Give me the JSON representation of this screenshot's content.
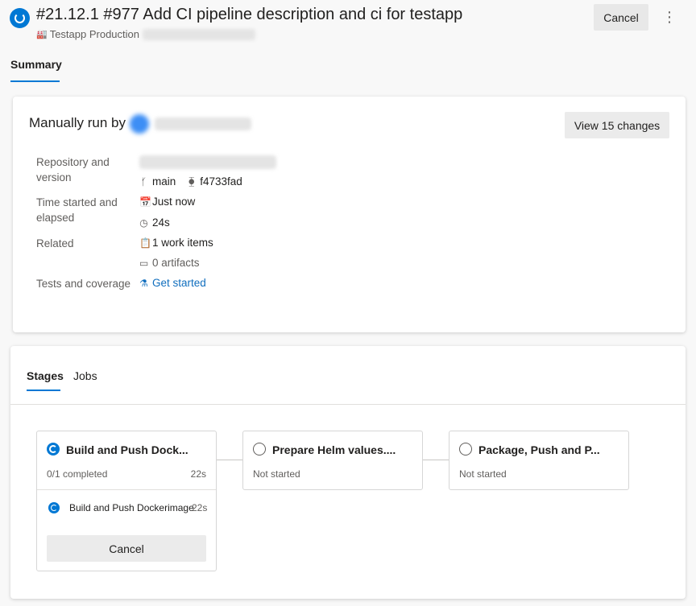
{
  "header": {
    "title": "#21.12.1 #977 Add CI pipeline description and ci for testapp",
    "project": "Testapp Production",
    "cancel_label": "Cancel",
    "more_icon": "⋮"
  },
  "tabs": {
    "summary": "Summary"
  },
  "summary": {
    "manually_run_by": "Manually run by",
    "view_changes_label": "View 15 changes",
    "repo_label": "Repository and version",
    "branch": "main",
    "commit": "f4733fad",
    "time_label": "Time started and elapsed",
    "started": "Just now",
    "elapsed": "24s",
    "related_label": "Related",
    "work_items": "1 work items",
    "artifacts": "0 artifacts",
    "tests_label": "Tests and coverage",
    "get_started": "Get started"
  },
  "pipeline": {
    "tab_stages": "Stages",
    "tab_jobs": "Jobs",
    "stages": [
      {
        "name": "Build and Push Dock...",
        "status": "0/1 completed",
        "time": "22s",
        "state": "running"
      },
      {
        "name": "Prepare Helm values....",
        "status": "Not started",
        "time": "",
        "state": "pending"
      },
      {
        "name": "Package, Push and P...",
        "status": "Not started",
        "time": "",
        "state": "pending"
      }
    ],
    "job": {
      "name": "Build and Push Dockerimage",
      "time": "22s"
    },
    "stage_cancel_label": "Cancel"
  },
  "colors": {
    "accent": "#0078d4",
    "link": "#106ebe"
  }
}
